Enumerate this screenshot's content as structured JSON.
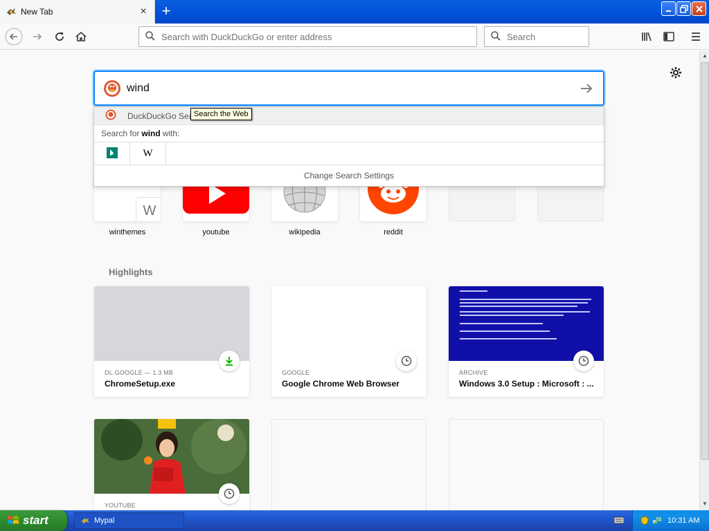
{
  "window": {
    "tab_title": "New Tab",
    "new_tab_symbol": "+",
    "close_symbol": "×"
  },
  "navbar": {
    "url_placeholder": "Search with DuckDuckGo or enter address",
    "search_placeholder": "Search"
  },
  "newtab": {
    "search_value": "wind",
    "dropdown": {
      "first_row_label": "DuckDuckGo Sea",
      "tooltip": "Search the Web",
      "search_for_prefix": "Search for",
      "search_for_term": "wind",
      "search_for_suffix": "with:",
      "engines": [
        "bing-icon",
        "wikipedia-icon"
      ],
      "change_settings": "Change Search Settings"
    },
    "top_sites": [
      {
        "label": "winthemes",
        "icon": "wikipedia-w-icon",
        "letter": "W"
      },
      {
        "label": "youtube",
        "icon": "youtube-icon"
      },
      {
        "label": "wikipedia",
        "icon": "wikipedia-globe-icon"
      },
      {
        "label": "reddit",
        "icon": "reddit-icon"
      },
      {
        "label": ""
      },
      {
        "label": ""
      }
    ],
    "highlights_title": "Highlights",
    "highlights": [
      {
        "source": "DL.GOOGLE — 1.3 MB",
        "title": "ChromeSetup.exe",
        "badge": "download-icon"
      },
      {
        "source": "GOOGLE",
        "title": "Google Chrome Web Browser",
        "badge": "clock-icon"
      },
      {
        "source": "ARCHIVE",
        "title": "Windows 3.0 Setup : Microsoft : ...",
        "badge": "clock-icon"
      },
      {
        "source": "YOUTUBE",
        "title": "",
        "badge": "clock-icon"
      }
    ]
  },
  "taskbar": {
    "start_label": "start",
    "task_label": "Mypal",
    "clock": "10:31 AM"
  },
  "colors": {
    "accent": "#0a84ff",
    "xp_blue": "#245edb",
    "start_green": "#2e8b2e",
    "youtube_red": "#ff0000",
    "reddit_orange": "#ff4500"
  }
}
